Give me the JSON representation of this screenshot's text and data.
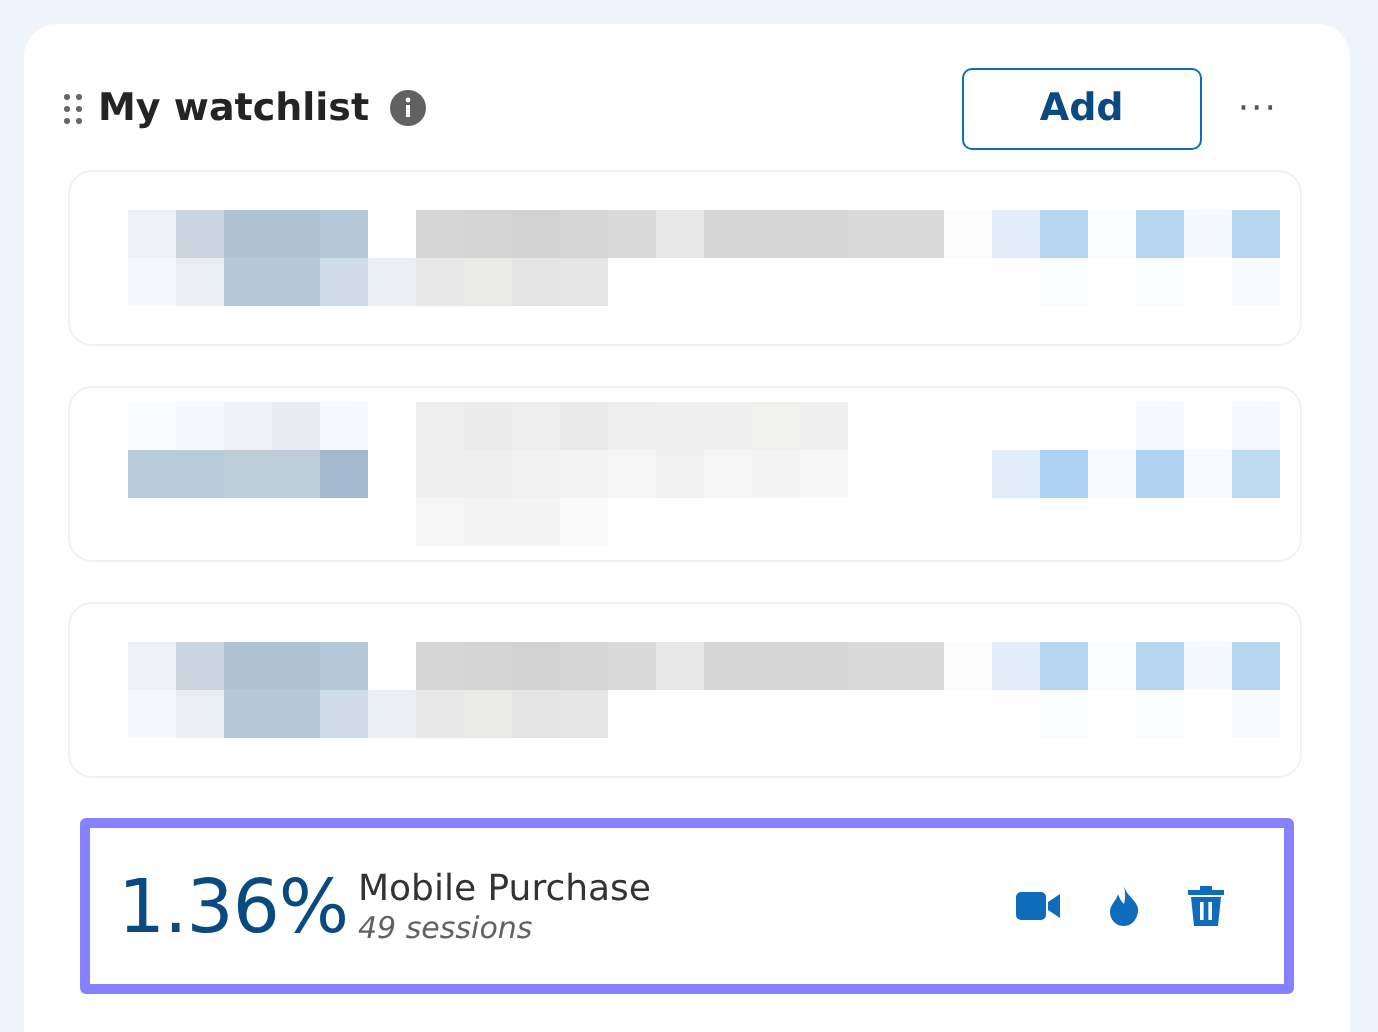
{
  "panel": {
    "title": "My watchlist",
    "add_button": "Add",
    "more_button": "···"
  },
  "items": [
    {
      "kind": "redacted"
    },
    {
      "kind": "redacted"
    },
    {
      "kind": "redacted"
    },
    {
      "kind": "metric",
      "value": "1.36%",
      "name": "Mobile Purchase",
      "sessions": "49 sessions",
      "highlighted": true
    }
  ]
}
